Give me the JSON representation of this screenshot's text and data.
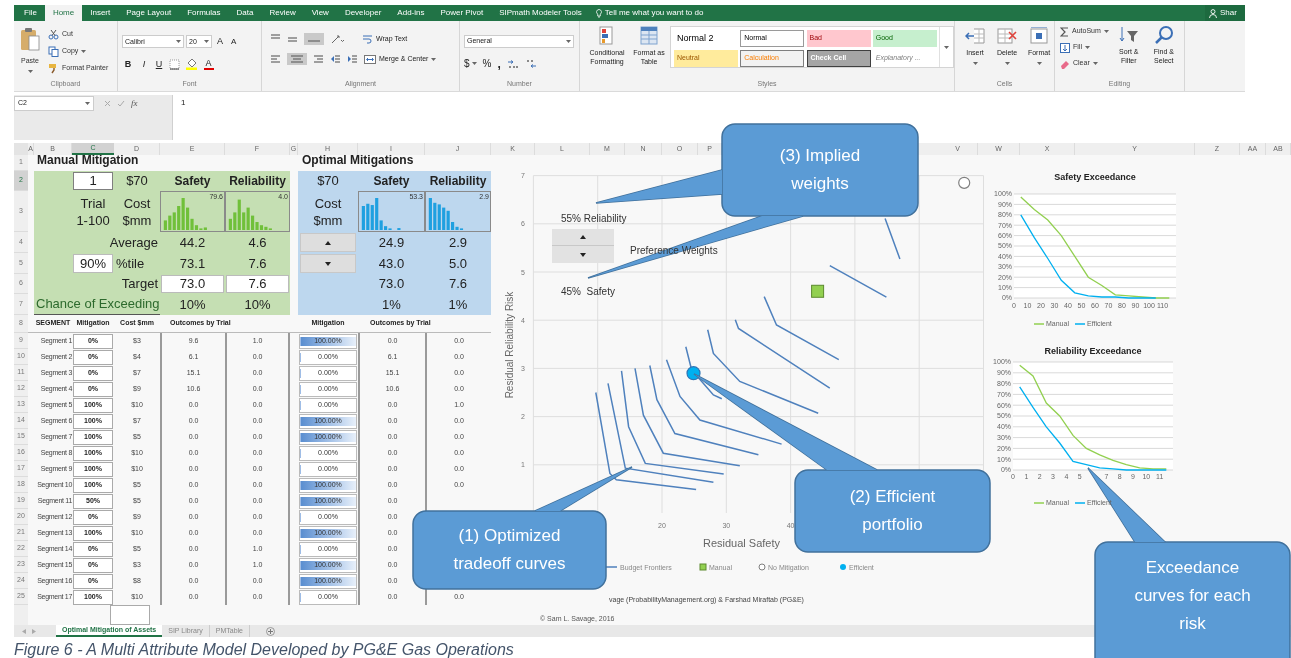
{
  "ribbon_tabs": [
    {
      "label": "File",
      "selected": false
    },
    {
      "label": "Home",
      "selected": true
    },
    {
      "label": "Insert",
      "selected": false
    },
    {
      "label": "Page Layout",
      "selected": false
    },
    {
      "label": "Formulas",
      "selected": false
    },
    {
      "label": "Data",
      "selected": false
    },
    {
      "label": "Review",
      "selected": false
    },
    {
      "label": "View",
      "selected": false
    },
    {
      "label": "Developer",
      "selected": false
    },
    {
      "label": "Add-ins",
      "selected": false
    },
    {
      "label": "Power Pivot",
      "selected": false
    },
    {
      "label": "SIPmath Modeler Tools",
      "selected": false
    }
  ],
  "tell_me": "Tell me what you want to do",
  "share": "Shar",
  "clipboard": {
    "label": "Clipboard",
    "paste": "Paste",
    "cut": "Cut",
    "copy": "Copy",
    "format_painter": "Format Painter"
  },
  "font": {
    "label": "Font",
    "name": "Calibri",
    "size": "20",
    "grow_font": "A",
    "shrink_font": "A",
    "bold": "B",
    "italic": "I",
    "underline": "U",
    "font_color": "A"
  },
  "alignment": {
    "label": "Alignment",
    "wrap_text": "Wrap Text",
    "merge_center": "Merge & Center"
  },
  "number": {
    "label": "Number",
    "format": "General",
    "currency": "$",
    "percent": "%",
    "comma": ","
  },
  "styles": {
    "label": "Styles",
    "conditional_formatting": "Conditional Formatting",
    "format_as_table": "Format as Table",
    "cell_styles": [
      {
        "label": "Normal 2",
        "kind": "normal2"
      },
      {
        "label": "Normal",
        "kind": "normal"
      },
      {
        "label": "Bad",
        "kind": "bad"
      },
      {
        "label": "Good",
        "kind": "good"
      },
      {
        "label": "Neutral",
        "kind": "neutral"
      },
      {
        "label": "Calculation",
        "kind": "calculation"
      },
      {
        "label": "Check Cell",
        "kind": "check"
      },
      {
        "label": "Explanatory ...",
        "kind": "explanatory"
      }
    ]
  },
  "cells": {
    "label": "Cells",
    "buttons": [
      {
        "label": "Insert",
        "kind": "insert"
      },
      {
        "label": "Delete",
        "kind": "delete"
      },
      {
        "label": "Format",
        "kind": "format"
      }
    ]
  },
  "editing": {
    "label": "Editing",
    "autosum": "AutoSum",
    "fill": "Fill",
    "clear": "Clear",
    "sort_filter": "Sort & Filter",
    "find_select": "Find & Select"
  },
  "formula_bar": {
    "name_box": "C2",
    "fx": "fx",
    "value": "1"
  },
  "column_headers": [
    {
      "label": "A",
      "selected": false
    },
    {
      "label": "B",
      "selected": false
    },
    {
      "label": "C",
      "selected": true
    },
    {
      "label": "D",
      "selected": false
    },
    {
      "label": "E",
      "selected": false
    },
    {
      "label": "F",
      "selected": false
    },
    {
      "label": "G",
      "selected": false
    },
    {
      "label": "H",
      "selected": false
    },
    {
      "label": "I",
      "selected": false
    },
    {
      "label": "J",
      "selected": false
    },
    {
      "label": "K",
      "selected": false
    },
    {
      "label": "L",
      "selected": false
    },
    {
      "label": "M",
      "selected": false
    },
    {
      "label": "N",
      "selected": false
    },
    {
      "label": "O",
      "selected": false
    },
    {
      "label": "P",
      "selected": false
    },
    {
      "label": "V",
      "selected": false
    },
    {
      "label": "W",
      "selected": false
    },
    {
      "label": "X",
      "selected": false
    },
    {
      "label": "Y",
      "selected": false
    },
    {
      "label": "Z",
      "selected": false
    },
    {
      "label": "AA",
      "selected": false
    },
    {
      "label": "AB",
      "selected": false
    }
  ],
  "row_headers": [
    {
      "label": "1",
      "selected": false
    },
    {
      "label": "2",
      "selected": true
    },
    {
      "label": "3",
      "selected": false
    },
    {
      "label": "4",
      "selected": false
    },
    {
      "label": "5",
      "selected": false
    },
    {
      "label": "6",
      "selected": false
    },
    {
      "label": "7",
      "selected": false
    },
    {
      "label": "8",
      "selected": false
    },
    {
      "label": "9",
      "selected": false
    },
    {
      "label": "10",
      "selected": false
    },
    {
      "label": "11",
      "selected": false
    },
    {
      "label": "12",
      "selected": false
    },
    {
      "label": "13",
      "selected": false
    },
    {
      "label": "14",
      "selected": false
    },
    {
      "label": "15",
      "selected": false
    },
    {
      "label": "16",
      "selected": false
    },
    {
      "label": "17",
      "selected": false
    },
    {
      "label": "18",
      "selected": false
    },
    {
      "label": "19",
      "selected": false
    },
    {
      "label": "20",
      "selected": false
    },
    {
      "label": "21",
      "selected": false
    },
    {
      "label": "22",
      "selected": false
    },
    {
      "label": "23",
      "selected": false
    },
    {
      "label": "24",
      "selected": false
    },
    {
      "label": "25",
      "selected": false
    }
  ],
  "manual": {
    "title": "Manual Mitigation",
    "trial": "1",
    "cost": "$70",
    "safety": "Safety",
    "reliability": "Reliability",
    "trial_label": "Trial",
    "trial_range": "1-100",
    "cost_label": "Cost",
    "cost_unit": "$mm",
    "safety_max": "79.6",
    "reliability_max": "4.0",
    "stats": [
      {
        "kind": "average",
        "label": "Average",
        "safety": "44.2",
        "reliability": "4.6"
      },
      {
        "kind": "percentile",
        "input": "90%",
        "label": "%tile",
        "safety": "73.1",
        "reliability": "7.6"
      },
      {
        "kind": "target",
        "label": "Target",
        "safety": "73.0",
        "reliability": "7.6"
      }
    ],
    "chance_label": "Chance of Exceeding",
    "chance_safety": "10%",
    "chance_reliability": "10%",
    "headers": [
      "SEGMENT",
      "Mitigation",
      "Cost $mm",
      "Outcomes by Trial"
    ],
    "rows": [
      {
        "segment": "Segment 1",
        "mitigation": "0%",
        "cost": "$3",
        "safety": "9.6",
        "reliability": "1.0"
      },
      {
        "segment": "Segment 2",
        "mitigation": "0%",
        "cost": "$4",
        "safety": "6.1",
        "reliability": "0.0"
      },
      {
        "segment": "Segment 3",
        "mitigation": "0%",
        "cost": "$7",
        "safety": "15.1",
        "reliability": "0.0"
      },
      {
        "segment": "Segment 4",
        "mitigation": "0%",
        "cost": "$9",
        "safety": "10.6",
        "reliability": "0.0"
      },
      {
        "segment": "Segment 5",
        "mitigation": "100%",
        "cost": "$10",
        "safety": "0.0",
        "reliability": "0.0"
      },
      {
        "segment": "Segment 6",
        "mitigation": "100%",
        "cost": "$7",
        "safety": "0.0",
        "reliability": "0.0"
      },
      {
        "segment": "Segment 7",
        "mitigation": "100%",
        "cost": "$5",
        "safety": "0.0",
        "reliability": "0.0"
      },
      {
        "segment": "Segment 8",
        "mitigation": "100%",
        "cost": "$10",
        "safety": "0.0",
        "reliability": "0.0"
      },
      {
        "segment": "Segment 9",
        "mitigation": "100%",
        "cost": "$10",
        "safety": "0.0",
        "reliability": "0.0"
      },
      {
        "segment": "Segment 10",
        "mitigation": "100%",
        "cost": "$5",
        "safety": "0.0",
        "reliability": "0.0"
      },
      {
        "segment": "Segment 11",
        "mitigation": "50%",
        "cost": "$5",
        "safety": "0.0",
        "reliability": "0.0"
      },
      {
        "segment": "Segment 12",
        "mitigation": "0%",
        "cost": "$9",
        "safety": "0.0",
        "reliability": "0.0"
      },
      {
        "segment": "Segment 13",
        "mitigation": "100%",
        "cost": "$10",
        "safety": "0.0",
        "reliability": "0.0"
      },
      {
        "segment": "Segment 14",
        "mitigation": "0%",
        "cost": "$5",
        "safety": "0.0",
        "reliability": "1.0"
      },
      {
        "segment": "Segment 15",
        "mitigation": "0%",
        "cost": "$3",
        "safety": "0.0",
        "reliability": "1.0"
      },
      {
        "segment": "Segment 16",
        "mitigation": "0%",
        "cost": "$8",
        "safety": "0.0",
        "reliability": "0.0"
      },
      {
        "segment": "Segment 17",
        "mitigation": "100%",
        "cost": "$10",
        "safety": "0.0",
        "reliability": "0.0"
      }
    ]
  },
  "optimal": {
    "title": "Optimal Mitigations",
    "cost": "$70",
    "safety": "Safety",
    "reliability": "Reliability",
    "cost_label": "Cost",
    "cost_unit": "$mm",
    "safety_max": "53.3",
    "reliability_max": "2.9",
    "stats": [
      {
        "safety": "24.9",
        "reliability": "2.9"
      },
      {
        "safety": "43.0",
        "reliability": "5.0"
      },
      {
        "safety": "73.0",
        "reliability": "7.6"
      },
      {
        "safety": "1%",
        "reliability": "1%"
      }
    ],
    "headers": [
      "Mitigation",
      "Outcomes by Trial"
    ],
    "rows": [
      {
        "mitigation": "100.00%",
        "level": 1,
        "safety": "0.0",
        "reliability": "0.0"
      },
      {
        "mitigation": "0.00%",
        "level": 0,
        "safety": "6.1",
        "reliability": "0.0"
      },
      {
        "mitigation": "0.00%",
        "level": 0,
        "safety": "15.1",
        "reliability": "0.0"
      },
      {
        "mitigation": "0.00%",
        "level": 0,
        "safety": "10.6",
        "reliability": "0.0"
      },
      {
        "mitigation": "0.00%",
        "level": 0,
        "safety": "0.0",
        "reliability": "1.0"
      },
      {
        "mitigation": "100.00%",
        "level": 1,
        "safety": "0.0",
        "reliability": "0.0"
      },
      {
        "mitigation": "100.00%",
        "level": 1,
        "safety": "0.0",
        "reliability": "0.0"
      },
      {
        "mitigation": "0.00%",
        "level": 0,
        "safety": "0.0",
        "reliability": "0.0"
      },
      {
        "mitigation": "0.00%",
        "level": 0,
        "safety": "0.0",
        "reliability": "0.0"
      },
      {
        "mitigation": "100.00%",
        "level": 1,
        "safety": "0.0",
        "reliability": "0.0"
      },
      {
        "mitigation": "100.00%",
        "level": 1,
        "safety": "0.0"
      },
      {
        "mitigation": "0.00%",
        "level": 0,
        "safety": "0.0"
      },
      {
        "mitigation": "100.00%",
        "level": 1,
        "safety": "0.0"
      },
      {
        "mitigation": "0.00%",
        "level": 0,
        "safety": "0.0"
      },
      {
        "mitigation": "100.00%",
        "level": 1,
        "safety": "0.0"
      },
      {
        "mitigation": "100.00%",
        "level": 1,
        "safety": "0.0"
      },
      {
        "mitigation": "0.00%",
        "level": 0,
        "safety": "0.0",
        "reliability": "0.0"
      }
    ]
  },
  "tradeoff_chart": {
    "reliability_weight": "55% Reliability",
    "weights_label": "Preference Weights",
    "safety_weight": "45%  Safety",
    "chart_data": {
      "type": "scatter",
      "xlabel": "Residual Safety",
      "ylabel": "Residual Reliability Risk",
      "xlim": [
        0,
        70
      ],
      "ylim": [
        0,
        7
      ],
      "xticks": [
        20,
        30,
        40
      ],
      "yticks": [
        1,
        2,
        3,
        4,
        5,
        6,
        7
      ],
      "grid": true,
      "legend": "bottom",
      "series": [
        {
          "name": "Budget Frontiers",
          "type": "line",
          "color": "#4f81bd",
          "x": [
            9.7,
            11.9,
            12.9,
            25.3,
            null,
            11.6,
            14.3,
            28.0,
            null,
            13.7,
            14.8,
            17.4,
            29.6,
            null,
            15.8,
            17.1,
            20.2,
            32.1,
            null,
            18.1,
            19.2,
            22.0,
            35.0,
            null,
            20.7,
            22.8,
            25.9,
            38.6,
            null,
            23.7,
            24.6,
            28.0,
            29.3,
            null,
            27.1,
            28.0,
            32.1,
            44.3,
            null,
            31.4,
            31.9,
            46.1,
            null,
            35.9,
            37.8,
            47.5,
            null,
            46.1,
            54.9,
            null,
            54.7,
            57.0
          ],
          "values": [
            2.5,
            0.82,
            0.69,
            0.49,
            null,
            2.69,
            0.93,
            0.64,
            null,
            2.95,
            1.79,
            1.03,
            0.81,
            null,
            3.0,
            2.03,
            1.24,
            0.98,
            null,
            3.06,
            2.35,
            1.65,
            1.21,
            null,
            3.18,
            2.42,
            1.93,
            1.43,
            null,
            3.45,
            2.97,
            2.45,
            2.37,
            null,
            3.8,
            3.31,
            2.73,
            2.07,
            null,
            4.01,
            3.83,
            2.59,
            null,
            4.49,
            3.9,
            3.18,
            null,
            5.13,
            4.48,
            null,
            6.11,
            5.27
          ]
        },
        {
          "name": "Manual",
          "color": "#92d050",
          "x": [
            44.2
          ],
          "values": [
            4.6
          ]
        },
        {
          "name": "No Mitigation",
          "color": "#7f7f7f",
          "x": [
            67
          ],
          "values": [
            6.85
          ]
        },
        {
          "name": "Efficient",
          "color": "#00b0f0",
          "x": [
            24.9
          ],
          "values": [
            2.9
          ]
        }
      ]
    },
    "credit": "vage (ProbabilityManagement.org) & Farshad Miraftab (PG&E)",
    "copyright": "© Sam L. Savage, 2016"
  },
  "exceedance_charts": [
    {
      "chart_data": {
        "type": "line",
        "title": "Safety Exceedance",
        "x": [
          5,
          15,
          25,
          35,
          45,
          55,
          65,
          75,
          85,
          95,
          105,
          115
        ],
        "xlim": [
          0,
          120
        ],
        "ylim": [
          0,
          100
        ],
        "xticks": [
          0,
          10,
          20,
          30,
          40,
          50,
          60,
          70,
          80,
          90,
          100,
          110
        ],
        "grid": true,
        "legend": "bottom",
        "yticks": [
          {
            "value": 0,
            "label": "0%"
          },
          {
            "value": 10,
            "label": "10%"
          },
          {
            "value": 20,
            "label": "20%"
          },
          {
            "value": 30,
            "label": "30%"
          },
          {
            "value": 40,
            "label": "40%"
          },
          {
            "value": 50,
            "label": "50%"
          },
          {
            "value": 60,
            "label": "60%"
          },
          {
            "value": 70,
            "label": "70%"
          },
          {
            "value": 80,
            "label": "80%"
          },
          {
            "value": 90,
            "label": "90%"
          },
          {
            "value": 100,
            "label": "100%"
          }
        ],
        "series": [
          {
            "name": "Manual",
            "color": "#92d050",
            "values": [
              97,
              85,
              75,
              60,
              40,
              20,
              12,
              3,
              2,
              1,
              0,
              0
            ]
          },
          {
            "name": "Efficient",
            "color": "#00b0f0",
            "values": [
              80,
              58,
              38,
              17,
              5,
              2,
              1,
              1,
              0,
              0,
              0,
              null
            ]
          }
        ]
      }
    },
    {
      "chart_data": {
        "type": "line",
        "title": "Reliability Exceedance",
        "x": [
          0.5,
          1.5,
          2.5,
          3.5,
          4.5,
          5.5,
          6.5,
          7.5,
          8.5,
          9.5,
          10.5,
          11.5
        ],
        "xlim": [
          0,
          12
        ],
        "ylim": [
          0,
          100
        ],
        "xticks": [
          0,
          1,
          2,
          3,
          4,
          5,
          7,
          8,
          9,
          10,
          11
        ],
        "grid": true,
        "legend": "bottom",
        "yticks": [
          {
            "value": 0,
            "label": "0%"
          },
          {
            "value": 10,
            "label": "10%"
          },
          {
            "value": 20,
            "label": "20%"
          },
          {
            "value": 30,
            "label": "30%"
          },
          {
            "value": 40,
            "label": "40%"
          },
          {
            "value": 50,
            "label": "50%"
          },
          {
            "value": 60,
            "label": "60%"
          },
          {
            "value": 70,
            "label": "70%"
          },
          {
            "value": 80,
            "label": "80%"
          },
          {
            "value": 90,
            "label": "90%"
          },
          {
            "value": 100,
            "label": "100%"
          }
        ],
        "series": [
          {
            "name": "Manual",
            "color": "#92d050",
            "values": [
              97,
              87,
              62,
              50,
              32,
              20,
              14,
              9,
              5,
              2,
              1,
              1
            ]
          },
          {
            "name": "Efficient",
            "color": "#00b0f0",
            "values": [
              77,
              58,
              40,
              25,
              8,
              5,
              2,
              1,
              0,
              0,
              0,
              0
            ]
          }
        ]
      }
    }
  ],
  "sheet_tabs": [
    {
      "label": "Optimal Mitigation of Assets",
      "selected": true
    },
    {
      "label": "SIP Library",
      "selected": false
    },
    {
      "label": "PMTable",
      "selected": false
    }
  ],
  "callouts": [
    {
      "text": "(3) Implied weights"
    },
    {
      "text": "(2) Efficient portfolio"
    },
    {
      "text": "(1) Optimized tradeoff curves"
    },
    {
      "text": "Exceedance curves for each risk"
    }
  ],
  "caption": "Figure 6 - A Multi Attribute Model Developed by PG&E Gas Operations"
}
